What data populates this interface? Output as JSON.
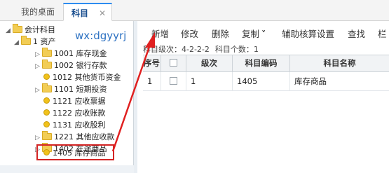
{
  "tabs": {
    "home_label": "我的桌面",
    "active_label": "科目",
    "close_glyph": "✕"
  },
  "tree": {
    "nodes": [
      {
        "label": "会计科目",
        "type": "folder",
        "expand": "open"
      },
      {
        "label": "1 资产",
        "type": "folder",
        "expand": "open"
      },
      {
        "label": "1001 库存现金",
        "type": "folder",
        "expand": "closed"
      },
      {
        "label": "1002 银行存款",
        "type": "folder",
        "expand": "closed"
      },
      {
        "label": "1012 其他货币资金",
        "type": "leaf",
        "expand": ""
      },
      {
        "label": "1101 短期投资",
        "type": "folder",
        "expand": "closed"
      },
      {
        "label": "1121 应收票据",
        "type": "leaf",
        "expand": ""
      },
      {
        "label": "1122 应收账款",
        "type": "leaf",
        "expand": ""
      },
      {
        "label": "1131 应收股利",
        "type": "leaf",
        "expand": ""
      },
      {
        "label": "1221 其他应收款",
        "type": "folder",
        "expand": "closed"
      },
      {
        "label": "1402 在途商品",
        "type": "folder",
        "expand": "closed"
      },
      {
        "label": "1405 库存商品",
        "type": "leaf",
        "expand": ""
      }
    ]
  },
  "watermark": "wx:dgyyrj",
  "toolbar": {
    "items": [
      "新增",
      "修改",
      "删除",
      "复制",
      "辅助核算设置",
      "查找",
      "栏"
    ],
    "dropdown_glyph": "˅"
  },
  "info": {
    "level_label": "科目级次：",
    "level_value": "4-2-2-2",
    "count_label": "科目个数：",
    "count_value": "1"
  },
  "grid": {
    "columns": [
      "序号",
      "",
      "级次",
      "科目编码",
      "科目名称"
    ],
    "rows": [
      {
        "index": "1",
        "level": "1",
        "code": "1405",
        "name": "库存商品"
      }
    ]
  },
  "colors": {
    "highlight": "#d32424",
    "arrow": "#e02020",
    "accent": "#2d8cf0"
  }
}
